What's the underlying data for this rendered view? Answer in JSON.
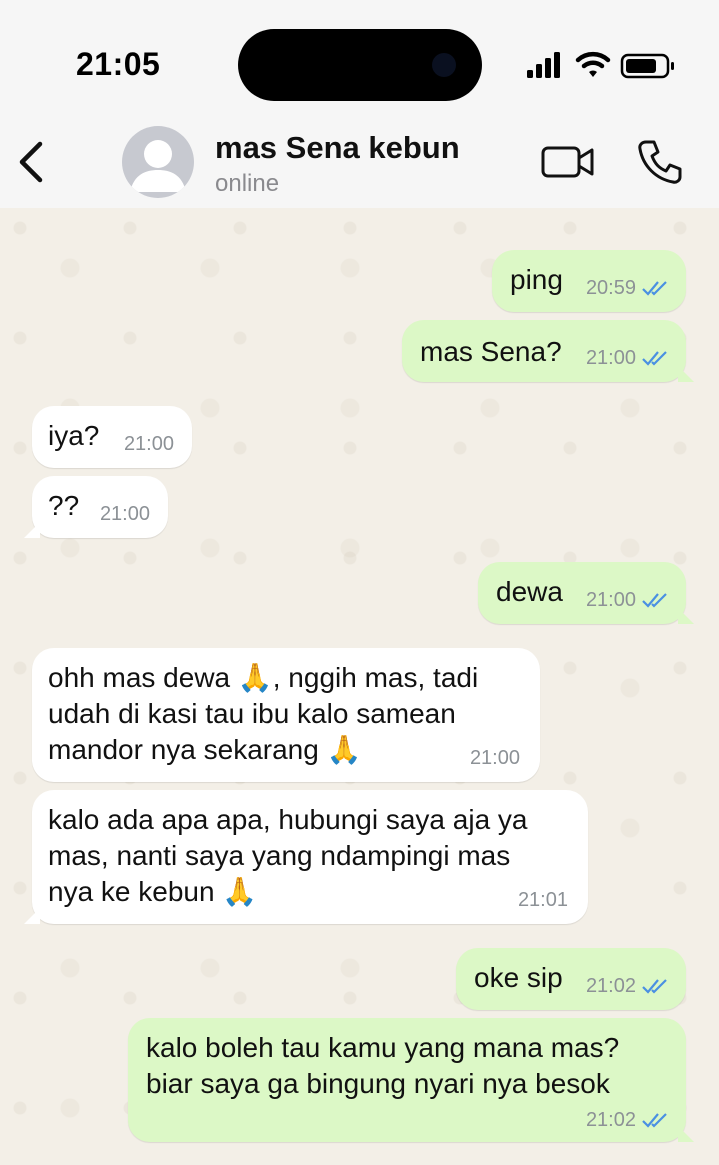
{
  "status_bar": {
    "time": "21:05"
  },
  "header": {
    "back_icon": "chevron-left-icon",
    "contact_name": "mas Sena kebun",
    "contact_status": "online",
    "video_icon": "video-camera-icon",
    "call_icon": "phone-icon"
  },
  "colors": {
    "outgoing_bubble": "#dcf8c6",
    "incoming_bubble": "#ffffff",
    "read_ticks": "#4a90e2"
  },
  "messages": [
    {
      "direction": "out",
      "text": "ping",
      "time": "20:59",
      "status": "read"
    },
    {
      "direction": "out",
      "text": "mas Sena?",
      "time": "21:00",
      "status": "read"
    },
    {
      "direction": "in",
      "text": "iya?",
      "time": "21:00"
    },
    {
      "direction": "in",
      "text": "??",
      "time": "21:00"
    },
    {
      "direction": "out",
      "text": "dewa",
      "time": "21:00",
      "status": "read"
    },
    {
      "direction": "in",
      "text": "ohh mas dewa 🙏, nggih mas, tadi\nudah di kasi tau ibu kalo samean\nmandor nya sekarang 🙏",
      "time": "21:00"
    },
    {
      "direction": "in",
      "text": "kalo ada apa apa, hubungi saya aja ya\nmas, nanti saya yang ndampingi mas\nnya ke kebun 🙏",
      "time": "21:01"
    },
    {
      "direction": "out",
      "text": "oke sip",
      "time": "21:02",
      "status": "read"
    },
    {
      "direction": "out",
      "text": "kalo boleh tau kamu yang mana mas?\nbiar saya ga bingung nyari nya besok",
      "time": "21:02",
      "status": "read"
    }
  ]
}
